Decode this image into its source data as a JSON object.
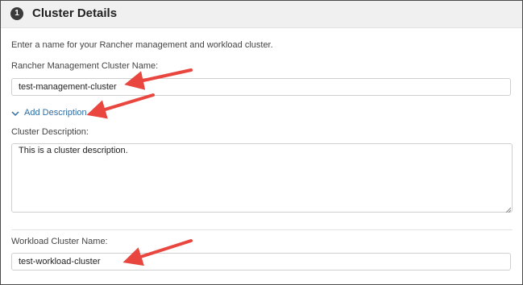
{
  "section": {
    "step_number": "1",
    "title": "Cluster Details"
  },
  "intro_text": "Enter a name for your Rancher management and workload cluster.",
  "management": {
    "label": "Rancher Management Cluster Name:",
    "value": "test-management-cluster"
  },
  "description_toggle": {
    "label": "Add Description"
  },
  "description": {
    "label": "Cluster Description:",
    "value": "This is a cluster description."
  },
  "workload": {
    "label": "Workload Cluster Name:",
    "value": "test-workload-cluster"
  },
  "colors": {
    "header_bg": "#f0f0f0",
    "link": "#2e6da4",
    "annotation_arrow": "#e8463f"
  },
  "icons": [
    "chevron-down-icon",
    "annotation-arrow"
  ]
}
